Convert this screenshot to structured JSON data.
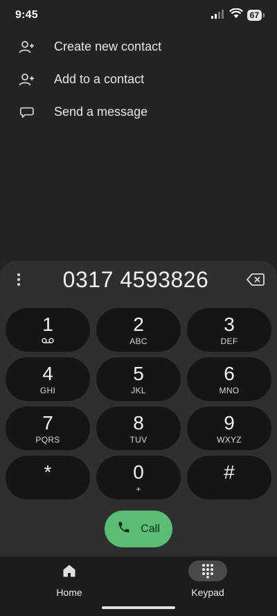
{
  "status_bar": {
    "time": "9:45",
    "battery": "67",
    "icons": [
      "signal-icon",
      "wifi-icon",
      "battery-icon"
    ]
  },
  "actions": [
    {
      "label": "Create new contact",
      "icon": "add-person-icon"
    },
    {
      "label": "Add to a contact",
      "icon": "add-person-icon"
    },
    {
      "label": "Send a message",
      "icon": "message-icon"
    }
  ],
  "dialer": {
    "number": "0317 4593826",
    "keys": [
      {
        "digit": "1",
        "letters": "",
        "icon": "voicemail-icon"
      },
      {
        "digit": "2",
        "letters": "ABC"
      },
      {
        "digit": "3",
        "letters": "DEF"
      },
      {
        "digit": "4",
        "letters": "GHI"
      },
      {
        "digit": "5",
        "letters": "JKL"
      },
      {
        "digit": "6",
        "letters": "MNO"
      },
      {
        "digit": "7",
        "letters": "PQRS"
      },
      {
        "digit": "8",
        "letters": "TUV"
      },
      {
        "digit": "9",
        "letters": "WXYZ"
      },
      {
        "digit": "*",
        "letters": ""
      },
      {
        "digit": "0",
        "letters": "+"
      },
      {
        "digit": "#",
        "letters": ""
      }
    ],
    "call_label": "Call"
  },
  "bottom_nav": {
    "items": [
      {
        "label": "Home",
        "icon": "home-icon",
        "active": false
      },
      {
        "label": "Keypad",
        "icon": "keypad-icon",
        "active": true
      }
    ]
  },
  "colors": {
    "background": "#232323",
    "dialpad_sheet": "#2f2f2f",
    "key_bg": "#151515",
    "call_green": "#5bbd74",
    "nav_bg": "#1c1c1c"
  }
}
